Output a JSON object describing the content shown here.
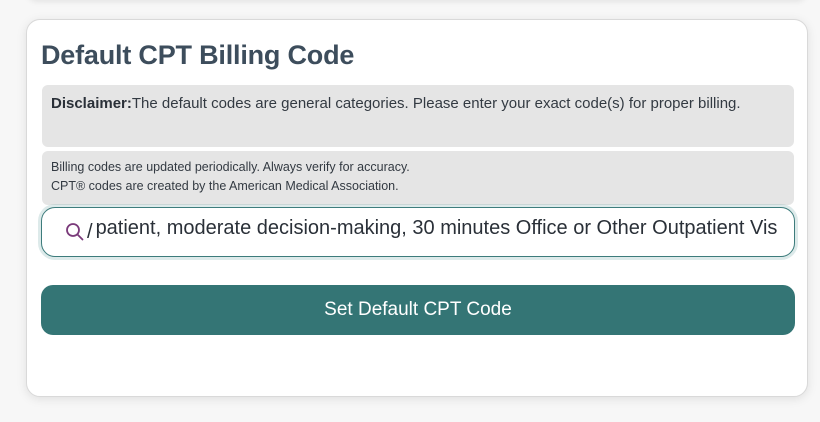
{
  "card": {
    "title": "Default CPT Billing Code"
  },
  "disclaimer": {
    "label": "Disclaimer:",
    "text": "The default codes are general categories. Please enter your exact code(s) for proper billing."
  },
  "notice": {
    "line1": "Billing codes are updated periodically. Always verify for accuracy.",
    "line2": "CPT® codes are created by the American Medical Association."
  },
  "search": {
    "value": "patient, moderate decision-making, 30 minutes Office or Other Outpatient Vis",
    "prefix_fragment": "/",
    "icon": "search-icon",
    "icon_color": "#7a3a7a"
  },
  "action": {
    "button_label": "Set Default CPT Code",
    "button_color": "#347575"
  }
}
